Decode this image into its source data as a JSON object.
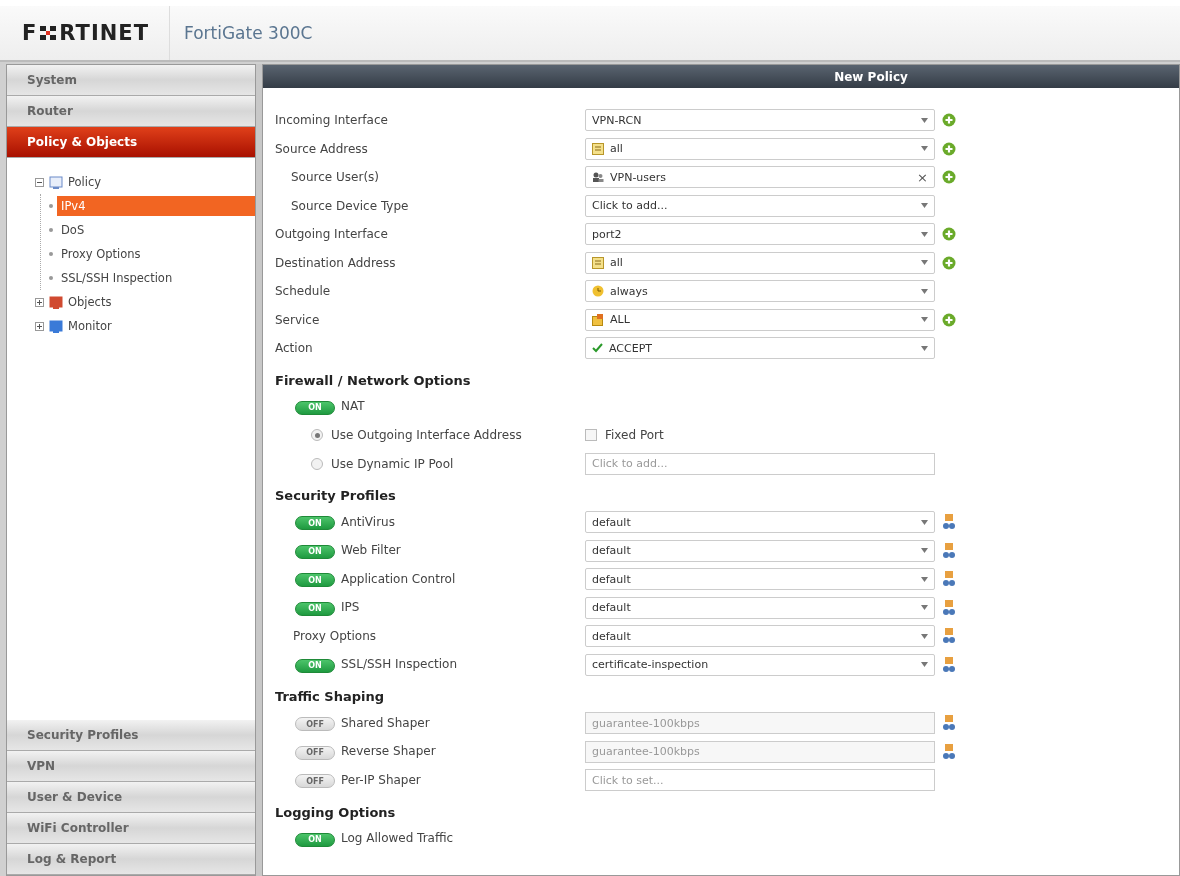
{
  "header": {
    "logo": {
      "before": "F",
      "after": "RTINET"
    },
    "device": "FortiGate 300C"
  },
  "sidebar": {
    "top_sections": [
      {
        "label": "System",
        "selected": false
      },
      {
        "label": "Router",
        "selected": false
      },
      {
        "label": "Policy & Objects",
        "selected": true
      }
    ],
    "tree": [
      {
        "label": "Policy",
        "kind": "policy",
        "expanded": true,
        "children": [
          {
            "label": "IPv4",
            "selected": true
          },
          {
            "label": "DoS",
            "selected": false
          },
          {
            "label": "Proxy Options",
            "selected": false
          },
          {
            "label": "SSL/SSH Inspection",
            "selected": false
          }
        ]
      },
      {
        "label": "Objects",
        "kind": "objects",
        "expanded": false
      },
      {
        "label": "Monitor",
        "kind": "monitor",
        "expanded": false
      }
    ],
    "bottom_sections": [
      {
        "label": "Security Profiles",
        "selected": false
      },
      {
        "label": "VPN",
        "selected": false
      },
      {
        "label": "User & Device",
        "selected": false
      },
      {
        "label": "WiFi Controller",
        "selected": false
      },
      {
        "label": "Log & Report",
        "selected": false
      }
    ]
  },
  "main": {
    "title": "New Policy",
    "fields": [
      {
        "label": "Incoming Interface",
        "indent": false,
        "value": "VPN-RCN",
        "kind": "plain",
        "add": true
      },
      {
        "label": "Source Address",
        "indent": false,
        "value": "all",
        "kind": "address",
        "add": true
      },
      {
        "label": "Source User(s)",
        "indent": true,
        "value": "VPN-users",
        "kind": "user",
        "clear_mark": "×",
        "add": true
      },
      {
        "label": "Source Device Type",
        "indent": true,
        "value": "Click to add...",
        "kind": "plain",
        "add": false
      },
      {
        "label": "Outgoing Interface",
        "indent": false,
        "value": "port2",
        "kind": "plain",
        "add": true
      },
      {
        "label": "Destination Address",
        "indent": false,
        "value": "all",
        "kind": "address",
        "add": true
      },
      {
        "label": "Schedule",
        "indent": false,
        "value": "always",
        "kind": "schedule",
        "add": false
      },
      {
        "label": "Service",
        "indent": false,
        "value": "ALL",
        "kind": "service",
        "add": true
      },
      {
        "label": "Action",
        "indent": false,
        "value": "ACCEPT",
        "kind": "accept",
        "add": false
      }
    ],
    "firewall": {
      "heading": "Firewall / Network Options",
      "nat": {
        "switch": "ON",
        "on": true,
        "label": "NAT"
      },
      "radios": [
        {
          "label": "Use Outgoing Interface Address",
          "selected": true
        },
        {
          "label": "Use Dynamic IP Pool",
          "selected": false
        }
      ],
      "fixed_port": {
        "label": "Fixed Port",
        "checked": false
      },
      "pool_field": {
        "placeholder": "Click to add..."
      }
    },
    "security": {
      "heading": "Security Profiles",
      "rows": [
        {
          "kind": "toggle",
          "switch": "ON",
          "on": true,
          "label": "AntiVirus",
          "value": "default"
        },
        {
          "kind": "toggle",
          "switch": "ON",
          "on": true,
          "label": "Web Filter",
          "value": "default"
        },
        {
          "kind": "toggle",
          "switch": "ON",
          "on": true,
          "label": "Application Control",
          "value": "default"
        },
        {
          "kind": "toggle",
          "switch": "ON",
          "on": true,
          "label": "IPS",
          "value": "default"
        },
        {
          "kind": "plain",
          "label": "Proxy Options",
          "value": "default"
        },
        {
          "kind": "toggle",
          "switch": "ON",
          "on": true,
          "label": "SSL/SSH Inspection",
          "value": "certificate-inspection"
        }
      ]
    },
    "shaping": {
      "heading": "Traffic Shaping",
      "rows": [
        {
          "switch": "OFF",
          "on": false,
          "label": "Shared Shaper",
          "placeholder": "guarantee-100kbps",
          "profile": true
        },
        {
          "switch": "OFF",
          "on": false,
          "label": "Reverse Shaper",
          "placeholder": "guarantee-100kbps",
          "profile": true
        },
        {
          "switch": "OFF",
          "on": false,
          "label": "Per-IP Shaper",
          "placeholder": "Click to set...",
          "profile": false
        }
      ]
    },
    "logging": {
      "heading": "Logging Options",
      "rows": [
        {
          "switch": "ON",
          "on": true,
          "label": "Log Allowed Traffic"
        }
      ]
    }
  }
}
